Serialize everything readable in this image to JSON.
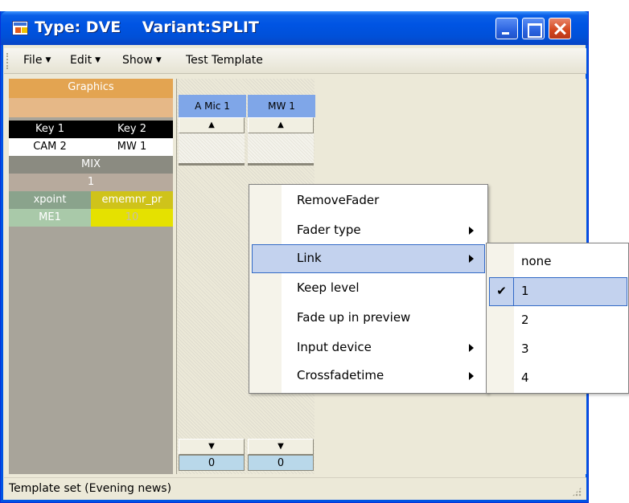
{
  "window": {
    "title": "Type: DVE    Variant:SPLIT",
    "controls": {
      "minimize_icon": "minimize-icon",
      "maximize_icon": "maximize-icon",
      "close_icon": "close-icon"
    }
  },
  "menubar": {
    "items": [
      {
        "label": "File",
        "has_dropdown": true
      },
      {
        "label": "Edit",
        "has_dropdown": true
      },
      {
        "label": "Show",
        "has_dropdown": true
      },
      {
        "label": "Test Template",
        "has_dropdown": false
      }
    ]
  },
  "graphics_panel": {
    "header": "Graphics",
    "keys": [
      {
        "label": "Key 1",
        "value": "CAM 2"
      },
      {
        "label": "Key 2",
        "value": "MW 1"
      }
    ],
    "mix_label": "MIX",
    "mix_value": "1",
    "xpoint_label": "xpoint",
    "ememnr_label": "ememnr_pr",
    "xpoint_value": "ME1",
    "ememnr_value": "10"
  },
  "faders": [
    {
      "name": "A Mic 1",
      "value": "0"
    },
    {
      "name": "MW 1",
      "value": "0"
    }
  ],
  "context_menu": {
    "items": [
      {
        "label": "RemoveFader",
        "submenu": false
      },
      {
        "label": "Fader type",
        "submenu": true
      },
      {
        "label": "Link",
        "submenu": true,
        "highlighted": true
      },
      {
        "label": "Keep level",
        "submenu": false
      },
      {
        "label": "Fade up in preview",
        "submenu": false
      },
      {
        "label": "Input device",
        "submenu": true
      },
      {
        "label": "Crossfadetime",
        "submenu": true
      }
    ]
  },
  "link_submenu": {
    "items": [
      {
        "label": "none",
        "checked": false
      },
      {
        "label": "1",
        "checked": true
      },
      {
        "label": "2",
        "checked": false
      },
      {
        "label": "3",
        "checked": false
      },
      {
        "label": "4",
        "checked": false
      }
    ]
  },
  "statusbar": {
    "text": "Template set (Evening news)"
  },
  "colors": {
    "title_blue": "#0054e3",
    "graphics_orange": "#e3a451",
    "fader_header_blue": "#7fa6e8",
    "menu_highlight": "#c3d2ee",
    "ememnr_yellow": "#cfc31a"
  }
}
